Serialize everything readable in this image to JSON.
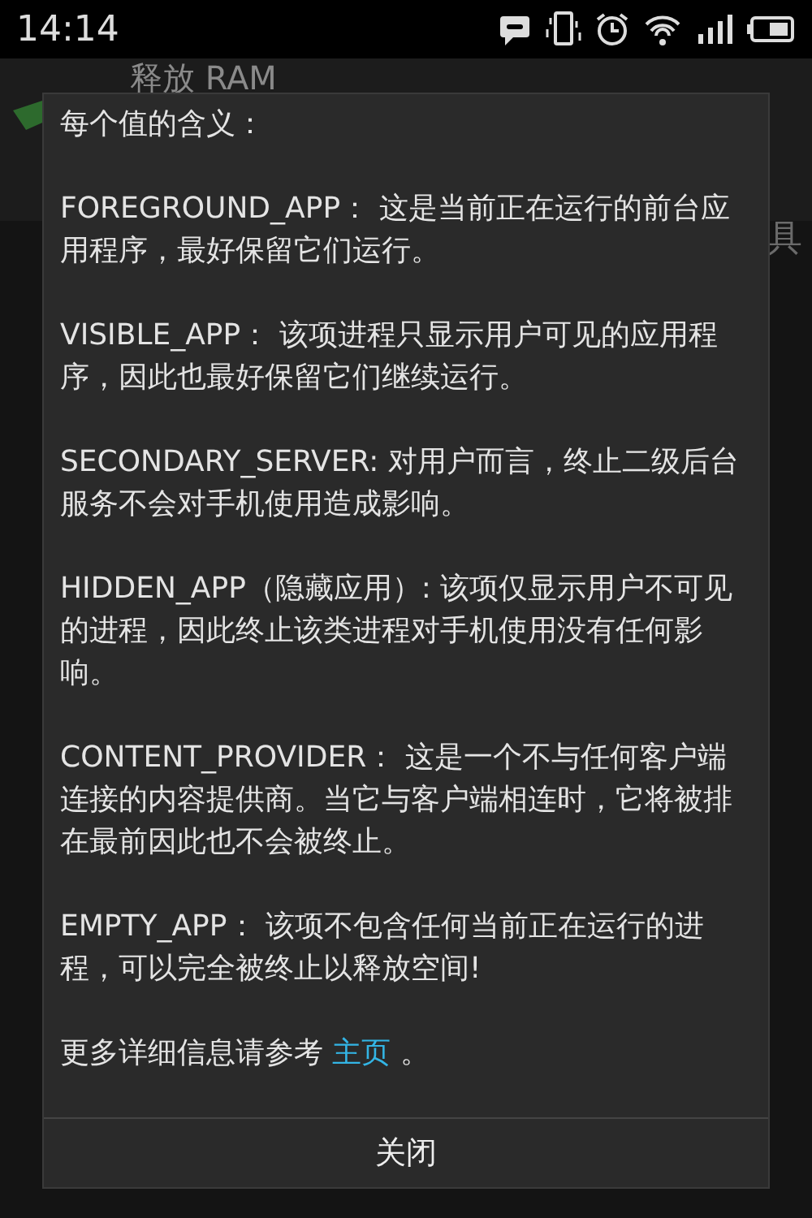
{
  "status_bar": {
    "time": "14:14"
  },
  "background": {
    "title": "释放 RAM",
    "tab": "具"
  },
  "dialog": {
    "heading": "每个值的含义：",
    "paragraphs": [
      "FOREGROUND_APP： 这是当前正在运行的前台应用程序，最好保留它们运行。",
      "VISIBLE_APP： 该项进程只显示用户可见的应用程序，因此也最好保留它们继续运行。",
      "SECONDARY_SERVER: 对用户而言，终止二级后台服务不会对手机使用造成影响。",
      "HIDDEN_APP（隐藏应用）: 该项仅显示用户不可见的进程，因此终止该类进程对手机使用没有任何影响。",
      "CONTENT_PROVIDER： 这是一个不与任何客户端连接的内容提供商。当它与客户端相连时，它将被排在最前因此也不会被终止。",
      "EMPTY_APP： 该项不包含任何当前正在运行的进程，可以完全被终止以释放空间!"
    ],
    "footer": {
      "text": "更多详细信息请参考 ",
      "link": "主页",
      "end": " 。"
    },
    "button": "关闭"
  }
}
